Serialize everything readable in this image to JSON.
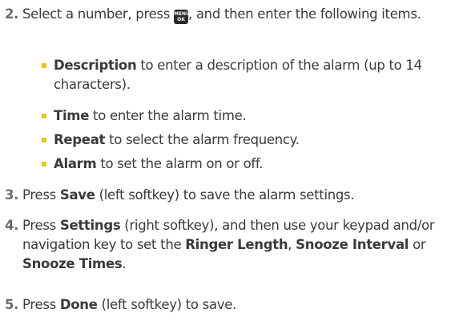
{
  "step2": {
    "number": "2.",
    "text_a": "Select a number, press ",
    "key_top": "MENU",
    "key_bottom": "OK",
    "text_b": ", and then enter the following items."
  },
  "items": [
    {
      "term": "Description",
      "text": " to enter a description of the alarm (up to 14 characters)."
    },
    {
      "term": "Time",
      "text": " to enter the alarm time."
    },
    {
      "term": "Repeat",
      "text": " to select the alarm frequency."
    },
    {
      "term": "Alarm",
      "text": " to set the alarm on or off."
    }
  ],
  "step3": {
    "number": "3.",
    "text_a": "Press ",
    "term": "Save",
    "text_b": " (left softkey) to save the alarm settings."
  },
  "step4": {
    "number": "4.",
    "text_a": "Press ",
    "term1": "Settings",
    "text_b": " (right softkey), and then use your keypad and/or navigation key to set the ",
    "term2": "Ringer Length",
    "text_c": ", ",
    "term3": "Snooze Interval",
    "text_d": " or ",
    "term4": "Snooze Times",
    "text_e": "."
  },
  "step5": {
    "number": "5.",
    "text_a": "Press ",
    "term": "Done",
    "text_b": " (left softkey) to save."
  },
  "colors": {
    "bullet": "#f0c419",
    "text": "#3a3a3a",
    "number": "#6b6b6b"
  }
}
